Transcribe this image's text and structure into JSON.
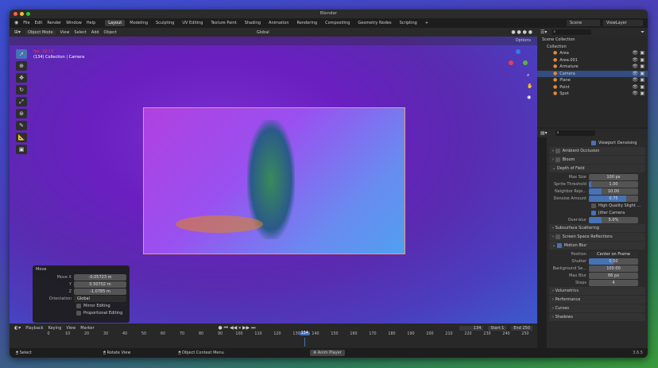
{
  "window": {
    "title": "Blender",
    "version": "3.6.5"
  },
  "menu": [
    "File",
    "Edit",
    "Render",
    "Window",
    "Help"
  ],
  "workspaces": [
    {
      "label": "Layout",
      "active": true
    },
    {
      "label": "Modeling"
    },
    {
      "label": "Sculpting"
    },
    {
      "label": "UV Editing"
    },
    {
      "label": "Texture Paint"
    },
    {
      "label": "Shading"
    },
    {
      "label": "Animation"
    },
    {
      "label": "Rendering"
    },
    {
      "label": "Compositing"
    },
    {
      "label": "Geometry Nodes"
    },
    {
      "label": "Scripting"
    },
    {
      "label": "+"
    }
  ],
  "scene": {
    "name": "Scene",
    "view_layer": "ViewLayer"
  },
  "viewport_header": {
    "mode": "Object Mode",
    "menus": [
      "View",
      "Select",
      "Add",
      "Object"
    ],
    "orientation": "Global",
    "options": "Options"
  },
  "viewport": {
    "fps": "fps: 19.13",
    "info": "(134) Collection | Camera"
  },
  "move_panel": {
    "title": "Move",
    "rows": [
      {
        "label": "Move X",
        "value": "-0.05723 m"
      },
      {
        "label": "Y",
        "value": "0.50702 m"
      },
      {
        "label": "Z",
        "value": "-1.0785 m"
      }
    ],
    "orientation_label": "Orientation",
    "orientation": "Global",
    "mirror": "Mirror Editing",
    "proportional": "Proportional Editing"
  },
  "outliner": {
    "root": "Scene Collection",
    "collection": "Collection",
    "items": [
      "Area",
      "Area.001",
      "Armature",
      "Camera",
      "Plane",
      "Point",
      "Spot"
    ],
    "selected": "Camera"
  },
  "properties": {
    "viewport_denoising": "Viewport Denoising",
    "ambient_occlusion": "Ambient Occlusion",
    "bloom": "Bloom",
    "depth_of_field": "Depth of Field",
    "dof_rows": [
      {
        "label": "Max Size",
        "value": "100 px",
        "fill": 0
      },
      {
        "label": "Sprite Threshold",
        "value": "1.00",
        "fill": 0.05
      },
      {
        "label": "Neighbor Reje...",
        "value": "10.00",
        "fill": 0.25
      },
      {
        "label": "Denoise Amount",
        "value": "0.75",
        "fill": 0.75
      }
    ],
    "high_quality": "High Quality Slight ...",
    "jitter": "Jitter Camera",
    "overblur": {
      "label": "Over-blur",
      "value": "5.0%",
      "fill": 0.25
    },
    "sss": "Subsurface Scattering",
    "ssr": "Screen Space Reflections",
    "motion_blur": "Motion Blur",
    "mb_position_label": "Position",
    "mb_position": "Center on Frame",
    "mb_rows": [
      {
        "label": "Shutter",
        "value": "0.50",
        "fill": 0.5
      },
      {
        "label": "Background Se...",
        "value": "100.00",
        "fill": 0
      },
      {
        "label": "Max Blur",
        "value": "66 px",
        "fill": 0
      },
      {
        "label": "Steps",
        "value": "4",
        "fill": 0
      }
    ],
    "more": [
      "Volumetrics",
      "Performance",
      "Curves",
      "Shadows"
    ]
  },
  "timeline": {
    "menus": [
      "Playback",
      "Keying",
      "View",
      "Marker"
    ],
    "current": "134",
    "start_label": "Start",
    "start": "1",
    "end_label": "End",
    "end": "250",
    "ticks": [
      0,
      10,
      20,
      30,
      40,
      50,
      60,
      70,
      80,
      90,
      100,
      110,
      120,
      130,
      140,
      150,
      160,
      170,
      180,
      190,
      200,
      210,
      220,
      230,
      240,
      250
    ]
  },
  "status": {
    "select": "Select",
    "rotate": "Rotate View",
    "context": "Object Context Menu",
    "anim": "Anim Player"
  },
  "colors": {
    "accent": "#4772b3",
    "selected_row": "#334d80"
  }
}
